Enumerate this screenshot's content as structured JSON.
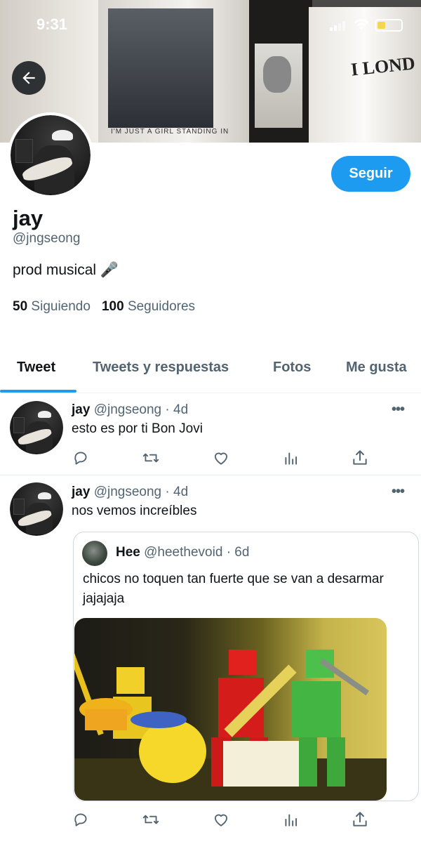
{
  "status_bar": {
    "time": "9:31",
    "battery_level": 0.35
  },
  "banner": {
    "shirt_caption": "I'M JUST A GIRL STANDING IN",
    "shirt_logo": "I LOND"
  },
  "profile": {
    "name": "jay",
    "handle": "@jngseong",
    "bio": "prod musical 🎤",
    "following_count": "50",
    "following_label": "Siguiendo",
    "followers_count": "100",
    "followers_label": "Seguidores",
    "follow_button": "Seguir"
  },
  "tabs": [
    {
      "label": "Tweet",
      "active": true
    },
    {
      "label": "Tweets y respuestas",
      "active": false
    },
    {
      "label": "Fotos",
      "active": false
    },
    {
      "label": "Me gusta",
      "active": false
    }
  ],
  "tweets": [
    {
      "author": "jay",
      "handle": "@jngseong",
      "time": "· 4d",
      "text": "esto es por ti Bon Jovi"
    },
    {
      "author": "jay",
      "handle": "@jngseong",
      "time": "· 4d",
      "text": "nos vemos increíbles",
      "quote": {
        "author": "Hee",
        "handle": "@heethevoid",
        "time": "· 6d",
        "text": "chicos no toquen tan fuerte que se van a desarmar jajajaja"
      }
    }
  ],
  "colors": {
    "accent": "#1d9bf0",
    "text": "#0f1419",
    "muted": "#536471"
  },
  "icons": [
    "back-arrow-icon",
    "more-icon",
    "reply-icon",
    "retweet-icon",
    "like-icon",
    "analytics-icon",
    "share-icon"
  ]
}
